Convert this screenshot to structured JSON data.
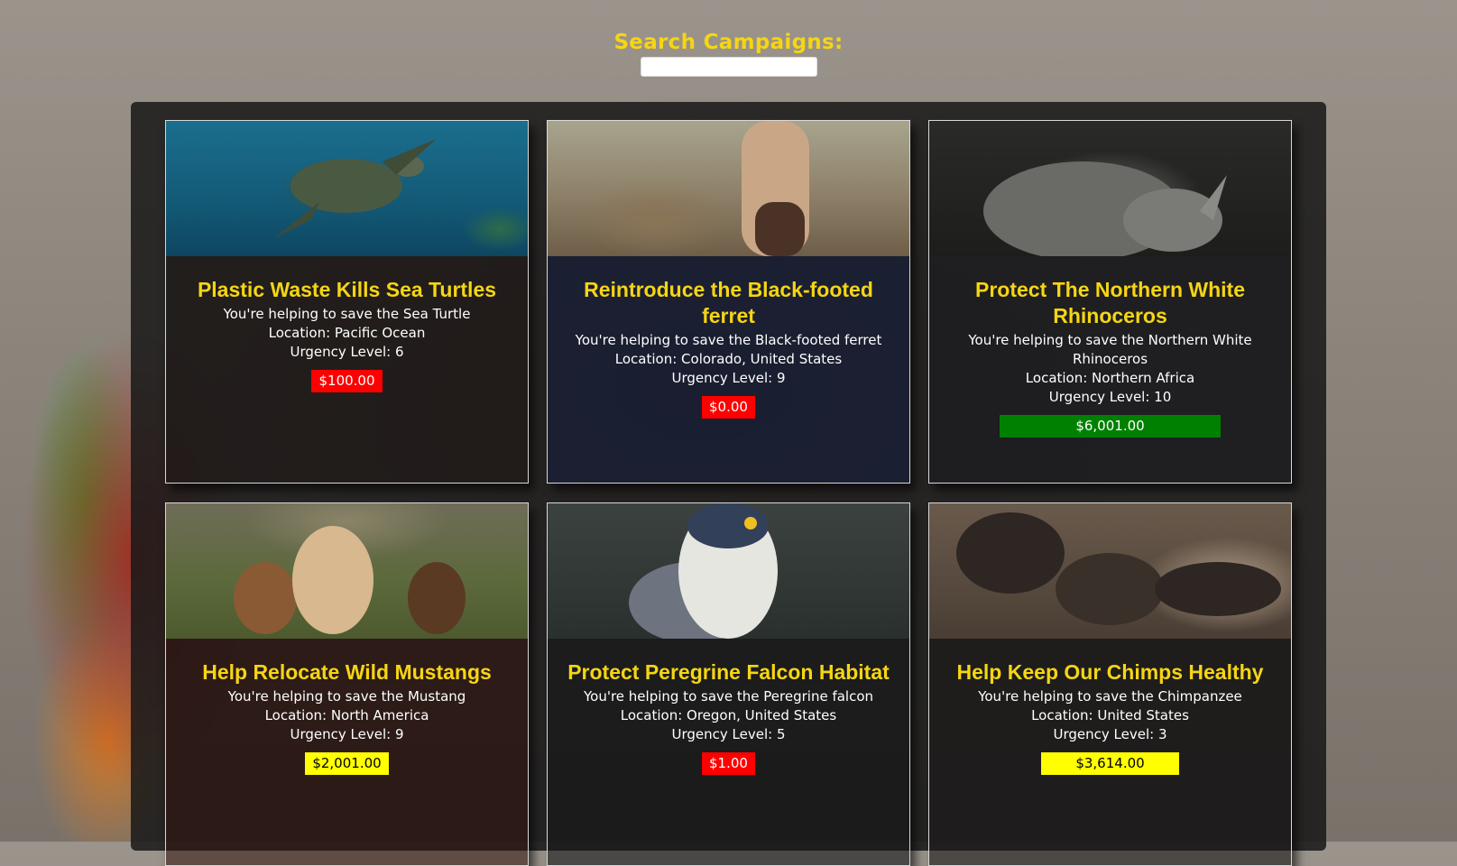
{
  "search": {
    "label": "Search Campaigns:",
    "value": ""
  },
  "campaigns": [
    {
      "title": "Plastic Waste Kills Sea Turtles",
      "save_text": "You're helping to save the Sea Turtle",
      "location": "Location: Pacific Ocean",
      "urgency": "Urgency Level: 6",
      "amount": "$100.00",
      "amount_color": "#ff0000",
      "image": "sea-turtle-photo"
    },
    {
      "title": "Reintroduce the Black-footed ferret",
      "save_text": "You're helping to save the Black-footed ferret",
      "location": "Location: Colorado, United States",
      "urgency": "Urgency Level: 9",
      "amount": "$0.00",
      "amount_color": "#ff0000",
      "image": "ferret-photo"
    },
    {
      "title": "Protect The Northern White Rhinoceros",
      "save_text": "You're helping to save the Northern White Rhinoceros",
      "location": "Location: Northern Africa",
      "urgency": "Urgency Level: 10",
      "amount": "$6,001.00",
      "amount_color": "#008000",
      "image": "rhinoceros-photo"
    },
    {
      "title": "Help Relocate Wild Mustangs",
      "save_text": "You're helping to save the Mustang",
      "location": "Location: North America",
      "urgency": "Urgency Level: 9",
      "amount": "$2,001.00",
      "amount_color": "#ffff00",
      "image": "mustangs-photo"
    },
    {
      "title": "Protect Peregrine Falcon Habitat",
      "save_text": "You're helping to save the Peregrine falcon",
      "location": "Location: Oregon, United States",
      "urgency": "Urgency Level: 5",
      "amount": "$1.00",
      "amount_color": "#ff0000",
      "image": "falcon-photo"
    },
    {
      "title": "Help Keep Our Chimps Healthy",
      "save_text": "You're helping to save the Chimpanzee",
      "location": "Location: United States",
      "urgency": "Urgency Level: 3",
      "amount": "$3,614.00",
      "amount_color": "#ffff00",
      "image": "chimpanzee-photo"
    }
  ]
}
